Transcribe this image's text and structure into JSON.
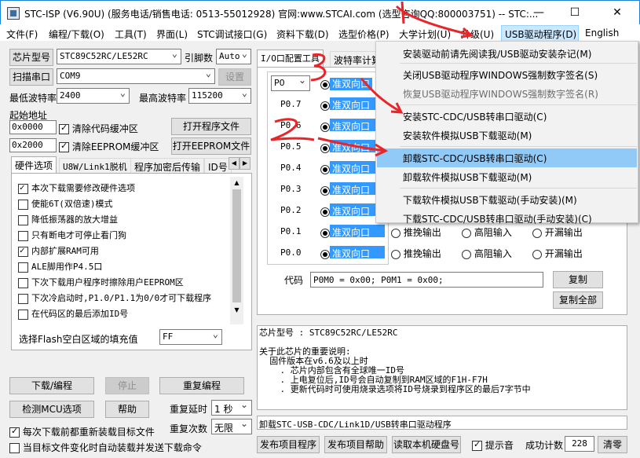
{
  "window": {
    "title": "STC-ISP (V6.90U) (服务电话/销售电话: 0513-55012928) 官网:www.STCAI.com  (选型咨询QQ:800003751) -- STC:...",
    "minimize": "—",
    "maximize": "☐",
    "close": "✕"
  },
  "menu": [
    "文件(F)",
    "编程/下载(O)",
    "工具(T)",
    "界面(L)",
    "STC调试接口(G)",
    "资料下载(D)",
    "选型价格(P)",
    "大学计划(U)",
    "升级(U)",
    "USB驱动程序(D)",
    "English"
  ],
  "left": {
    "chip_btn": "芯片型号",
    "chip_value": "STC89C52RC/LE52RC",
    "pins_label": "引脚数",
    "pins_value": "Auto",
    "scan_btn": "扫描串口",
    "port_value": "COM9",
    "settings_btn": "设置",
    "min_baud_label": "最低波特率",
    "min_baud_value": "2400",
    "max_baud_label": "最高波特率",
    "max_baud_value": "115200",
    "start_addr_label": "起始地址",
    "addr1": "0x0000",
    "clear_code": "清除代码缓冲区",
    "open_prog": "打开程序文件",
    "addr2": "0x2000",
    "clear_eeprom": "清除EEPROM缓冲区",
    "open_eeprom": "打开EEPROM文件",
    "tabs": [
      "硬件选项",
      "U8W/Link1脱机",
      "程序加密后传输",
      "ID号"
    ],
    "options": [
      {
        "label": "本次下载需要修改硬件选项",
        "checked": true
      },
      {
        "label": "使能6T(双倍速)模式",
        "checked": false
      },
      {
        "label": "降低振荡器的放大增益",
        "checked": false
      },
      {
        "label": "只有断电才可停止看门狗",
        "checked": false
      },
      {
        "label": "内部扩展RAM可用",
        "checked": true
      },
      {
        "label": "ALE脚用作P4.5口",
        "checked": false
      },
      {
        "label": "下次下载用户程序时擦除用户EEPROM区",
        "checked": false
      },
      {
        "label": "下次冷启动时,P1.0/P1.1为0/0才可下载程序",
        "checked": false
      },
      {
        "label": "在代码区的最后添加ID号",
        "checked": false
      }
    ],
    "fill_label": "选择Flash空白区域的填充值",
    "fill_value": "FF",
    "download_btn": "下载/编程",
    "stop_btn": "停止",
    "reprogram_btn": "重复编程",
    "detect_btn": "检测MCU选项",
    "help_btn": "帮助",
    "repeat_delay_label": "重复延时",
    "repeat_delay_value": "1 秒",
    "reload_label": "每次下载前都重新装载目标文件",
    "repeat_count_label": "重复次数",
    "repeat_count_value": "无限",
    "auto_load_label": "当目标文件变化时自动装载并发送下载命令"
  },
  "right": {
    "tabs": [
      "I/O口配置工具",
      "波特率计算"
    ],
    "port_select": "P0",
    "header_mode": "准双向口",
    "pins": [
      {
        "name": "P0.7",
        "mode": "准双向口"
      },
      {
        "name": "P0.6",
        "mode": "准双向口"
      },
      {
        "name": "P0.5",
        "mode": "准双向口"
      },
      {
        "name": "P0.4",
        "mode": "准双向口"
      },
      {
        "name": "P0.3",
        "mode": "准双向口"
      },
      {
        "name": "P0.2",
        "mode": "准双向口"
      },
      {
        "name": "P0.1",
        "mode": "准双向口"
      },
      {
        "name": "P0.0",
        "mode": "准双向口"
      }
    ],
    "push_pull": "推挽输出",
    "high_z": "高阻输入",
    "open_drain": "开漏输出",
    "code_label": "代码",
    "code_value": "P0M0 = 0x00;  P0M1 = 0x00;",
    "copy_btn": "复制",
    "copy_all_btn": "复制全部",
    "info_lines": [
      "芯片型号 : STC89C52RC/LE52RC",
      "",
      "关于此芯片的重要说明:",
      "  固件版本在v6.6及以上时",
      "    . 芯片内部包含有全球唯一ID号",
      "    . 上电复位后,ID号会自动复制到RAM区域的F1H-F7H",
      "    . 更新代码时可使用烧录选项将ID号烧录到程序区的最后7字节中"
    ],
    "status": "卸载STC-USB-CDC/Link1D/USB转串口驱动程序",
    "publish_btn": "发布项目程序",
    "publish_help_btn": "发布项目帮助",
    "read_disk_btn": "读取本机硬盘号",
    "beep_label": "提示音",
    "success_label": "成功计数",
    "success_value": "228",
    "clear_btn": "清零"
  },
  "usb_menu": [
    {
      "label": "安装驱动前请先阅读我/USB驱动安装杂记(M)",
      "state": "normal"
    },
    {
      "label": "关闭USB驱动程序WINDOWS强制数字签名(S)",
      "state": "normal"
    },
    {
      "label": "恢复USB驱动程序WINDOWS强制数字签名(R)",
      "state": "disabled"
    },
    {
      "label": "安装STC-CDC/USB转串口驱动(C)",
      "state": "normal"
    },
    {
      "label": "安装软件模拟USB下载驱动(M)",
      "state": "normal"
    },
    {
      "label": "卸载STC-CDC/USB转串口驱动(C)",
      "state": "selected"
    },
    {
      "label": "卸载软件模拟USB下载驱动(M)",
      "state": "normal"
    },
    {
      "label": "下载软件模拟USB下载驱动(手动安装)(M)",
      "state": "normal"
    },
    {
      "label": "下载STC-CDC/USB转串口驱动(手动安装)(C)",
      "state": "normal"
    }
  ],
  "annotations": {
    "one": "1",
    "two": "2",
    "three": "3",
    "color": "#e8262a"
  }
}
